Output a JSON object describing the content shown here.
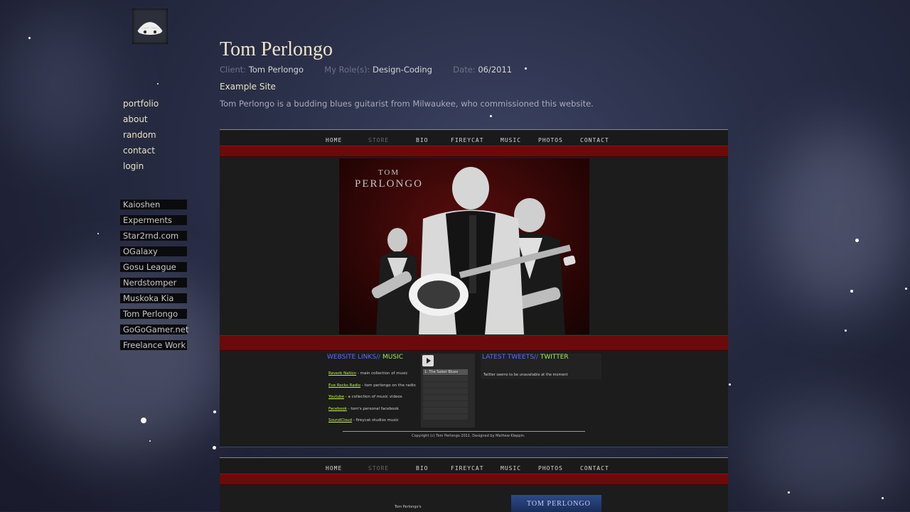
{
  "sidebar": {
    "nav": [
      "portfolio",
      "about",
      "random",
      "contact",
      "login"
    ],
    "links": [
      "Kaioshen",
      "Experments",
      "Star2rnd.com",
      "OGalaxy",
      "Gosu League",
      "Nerdstomper",
      "Muskoka Kia",
      "Tom Perlongo",
      "GoGoGamer.net",
      "Freelance Work"
    ]
  },
  "project": {
    "title": "Tom Perlongo",
    "client_label": "Client:",
    "client": "Tom Perlongo",
    "role_label": "My Role(s):",
    "role": "Design-Coding",
    "date_label": "Date:",
    "date": "06/2011",
    "example_link": "Example Site",
    "description": "Tom Perlongo is a budding blues guitarist from Milwaukee, who commissioned this website."
  },
  "screenshot1": {
    "nav": [
      "HOME",
      "STORE",
      "BIO",
      "FIREYCAT",
      "MUSIC",
      "PHOTOS",
      "CONTACT"
    ],
    "brand_line1": "TOM",
    "brand_line2": "PERLONGO",
    "links_heading_a": "WEBSITE LINKS//",
    "links_heading_b": "MUSIC",
    "link_rows": [
      {
        "name": "Reverb Nation",
        "desc": " - main collection of music"
      },
      {
        "name": "Eve Rocks Radio",
        "desc": " - tom perlongo on the radio"
      },
      {
        "name": "Youtube",
        "desc": " - a collection of music videos"
      },
      {
        "name": "Facebook",
        "desc": " - tom's personal facebook"
      },
      {
        "name": "SoundCloud",
        "desc": " - fireycat studios music"
      }
    ],
    "tweets_heading_a": "LATEST TWEETS//",
    "tweets_heading_b": "TWITTER",
    "tweets_text": "Twitter seems to be unavailable at the moment",
    "player_selected": "1. The Saber Blues",
    "copyright": "Copyright (c) Tom Perlongo 2011. Designed by Mathew Kleppin."
  },
  "screenshot2": {
    "nav": [
      "HOME",
      "STORE",
      "BIO",
      "FIREYCAT",
      "MUSIC",
      "PHOTOS",
      "CONTACT"
    ],
    "text": "Tom Perlongo's",
    "img_text": "TOM PERLONGO"
  },
  "colors": {
    "nav_link": "#e9e2c6",
    "meta_key": "#6e7187",
    "red_bar": "#6b0a0a",
    "blue_heading": "#5a6cff",
    "green_heading": "#9cf25e"
  }
}
